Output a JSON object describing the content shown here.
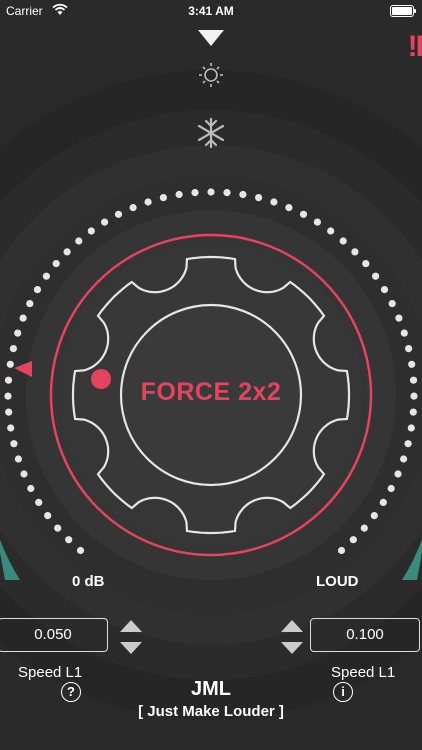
{
  "status_bar": {
    "carrier": "Carrier",
    "time": "3:41 AM"
  },
  "alert_text": "!I",
  "dial": {
    "center_label": "FORCE 2x2",
    "left_label": "0 dB",
    "right_label": "LOUD"
  },
  "left_control": {
    "value": "0.050",
    "label": "Speed L1",
    "help_glyph": "?"
  },
  "right_control": {
    "value": "0.100",
    "label": "Speed L1",
    "info_glyph": "i"
  },
  "footer": {
    "title": "JML",
    "subtitle": "[ Just Make Louder ]"
  },
  "colors": {
    "accent": "#e5435f",
    "teal": "#3a8a7e",
    "background": "#2a2a2a"
  },
  "icons": [
    "wifi-icon",
    "battery-icon",
    "top-triangle-icon",
    "sun-icon",
    "snowflake-icon",
    "left-pointer-icon",
    "knob-indicator-dot",
    "help-icon",
    "info-icon"
  ]
}
